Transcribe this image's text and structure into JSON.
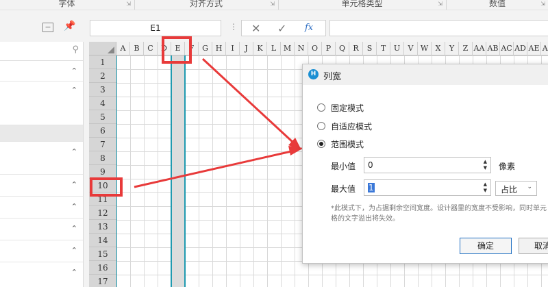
{
  "ribbon": {
    "groups": [
      {
        "label": "字体"
      },
      {
        "label": "对齐方式"
      },
      {
        "label": "单元格类型"
      },
      {
        "label": "数值"
      }
    ]
  },
  "formula_bar": {
    "name_box_value": "E1",
    "fx_label": "fx"
  },
  "grid": {
    "columns": [
      "A",
      "B",
      "C",
      "D",
      "E",
      "F",
      "G",
      "H",
      "I",
      "J",
      "K",
      "L",
      "M",
      "N",
      "O",
      "P",
      "Q",
      "R",
      "S",
      "T",
      "U",
      "V",
      "W",
      "X",
      "Y",
      "Z",
      "AA",
      "AB",
      "AC",
      "AD",
      "AE",
      "AF"
    ],
    "rows": [
      "1",
      "2",
      "3",
      "4",
      "5",
      "6",
      "7",
      "8",
      "9",
      "10",
      "11",
      "12",
      "13",
      "14",
      "15",
      "16",
      "17"
    ]
  },
  "dialog": {
    "title": "列宽",
    "modes": [
      {
        "label": "固定模式",
        "selected": false
      },
      {
        "label": "自适应模式",
        "selected": false
      },
      {
        "label": "范围模式",
        "selected": true
      }
    ],
    "min_label": "最小值",
    "min_value": "0",
    "min_unit": "像素",
    "max_label": "最大值",
    "max_value": "1",
    "max_unit": "占比",
    "note": "*此模式下，为占据剩余空间宽度。设计器里的宽度不受影响，同时单元格的文字溢出将失效。",
    "ok_label": "确定",
    "cancel_label": "取消"
  },
  "colors": {
    "highlight": "#e83a3a",
    "arrow": "#e83a3a",
    "column_border": "#1f9ab0",
    "ok_border": "#1f6fc2"
  }
}
